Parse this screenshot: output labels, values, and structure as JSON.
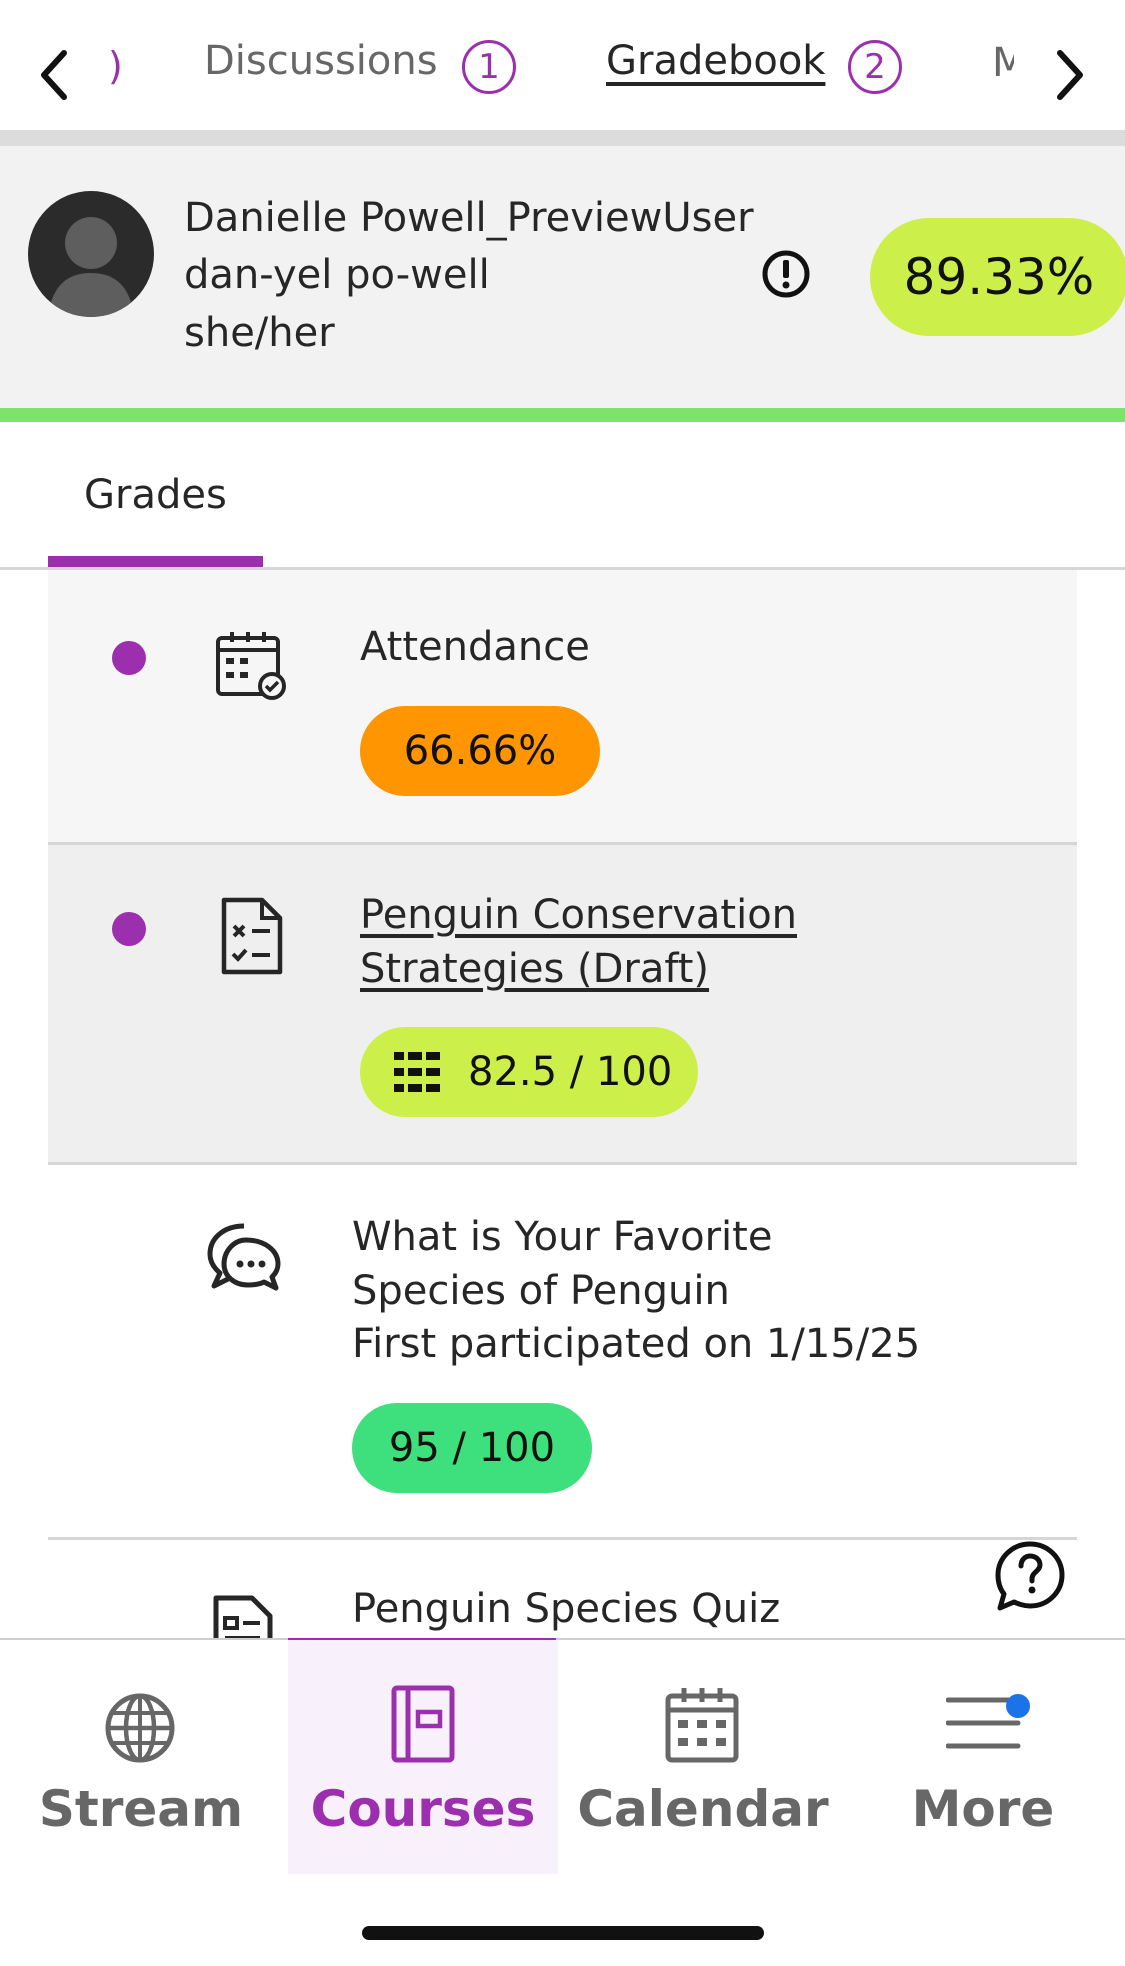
{
  "top_tabs": {
    "prev_partial": ")",
    "discussions_label": "Discussions",
    "discussions_count": "1",
    "gradebook_label": "Gradebook",
    "gradebook_count": "2",
    "next_partial": "M"
  },
  "student": {
    "name": "Danielle Powell_PreviewUser",
    "pronunciation": "dan-yel po-well",
    "pronouns": "she/her",
    "overall_grade": "89.33%"
  },
  "grades_tab_label": "Grades",
  "items": [
    {
      "title": "Attendance",
      "grade": "66.66%",
      "grade_color": "#ff9500",
      "icon": "attendance-calendar-icon"
    },
    {
      "title_line1": "Penguin Conservation",
      "title_line2": "Strategies (Draft)",
      "grade": "82.5 / 100",
      "grade_color": "#cdef4a",
      "icon": "assignment-icon"
    },
    {
      "title_line1": "What is Your Favorite",
      "title_line2": "Species of Penguin",
      "subtitle": "First participated on 1/15/25",
      "grade": "95 / 100",
      "grade_color": "#3ee07e",
      "icon": "discussion-icon"
    },
    {
      "title": "Penguin Species Quiz",
      "icon": "quiz-icon"
    }
  ],
  "bottom_nav": {
    "stream": "Stream",
    "courses": "Courses",
    "calendar": "Calendar",
    "more": "More"
  },
  "colors": {
    "accent": "#9b2fae",
    "overall_grade_bg": "#cdef4a",
    "header_bar_green": "#7fe36a",
    "notification_dot": "#1a73e8"
  }
}
